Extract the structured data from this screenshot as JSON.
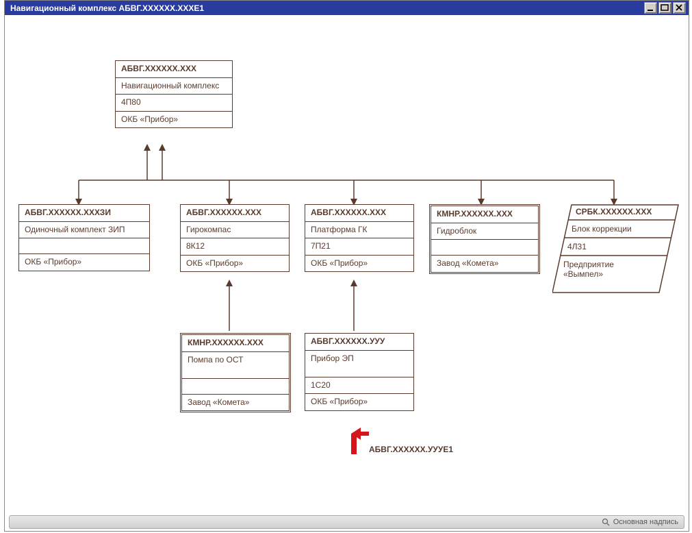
{
  "window": {
    "title": "Навигационный комплекс АБВГ.ХХХХХХ.ХХХЕ1"
  },
  "nodes": {
    "root": {
      "code": "АБВГ.ХХХХХХ.ХХХ",
      "desc": "Навигационный комплекс",
      "num": "4П80",
      "mfr": "ОКБ «Прибор»"
    },
    "n1": {
      "code": "АБВГ.ХХХХХХ.ХХХЗИ",
      "desc": "Одиночный комплект ЗИП",
      "num": "",
      "mfr": "ОКБ «Прибор»"
    },
    "n2": {
      "code": "АБВГ.ХХХХХХ.ХХХ",
      "desc": "Гирокомпас",
      "num": "8К12",
      "mfr": "ОКБ «Прибор»"
    },
    "n3": {
      "code": "АБВГ.ХХХХХХ.ХХХ",
      "desc": "Платформа ГК",
      "num": "7П21",
      "mfr": "ОКБ «Прибор»"
    },
    "n4": {
      "code": "КМНР.ХХХХХХ.ХХХ",
      "desc": "Гидроблок",
      "num": "",
      "mfr": "Завод «Комета»"
    },
    "n5": {
      "code": "СРБК.ХХХХХХ.ХХХ",
      "desc": "Блок коррекции",
      "num": "4Л31",
      "mfr": "Предприятие «Вымпел»"
    },
    "n6": {
      "code": "КМНР.ХХХХХХ.ХХХ",
      "desc": "Помпа по ОСТ",
      "num": "",
      "mfr": "Завод «Комета»"
    },
    "n7": {
      "code": "АБВГ.ХХХХХХ.УУУ",
      "desc": "Прибор ЭП",
      "num": "1С20",
      "mfr": "ОКБ «Прибор»"
    }
  },
  "callout": "АБВГ.ХХХХХХ.УУУЕ1",
  "status": {
    "text": "Основная надпись"
  }
}
